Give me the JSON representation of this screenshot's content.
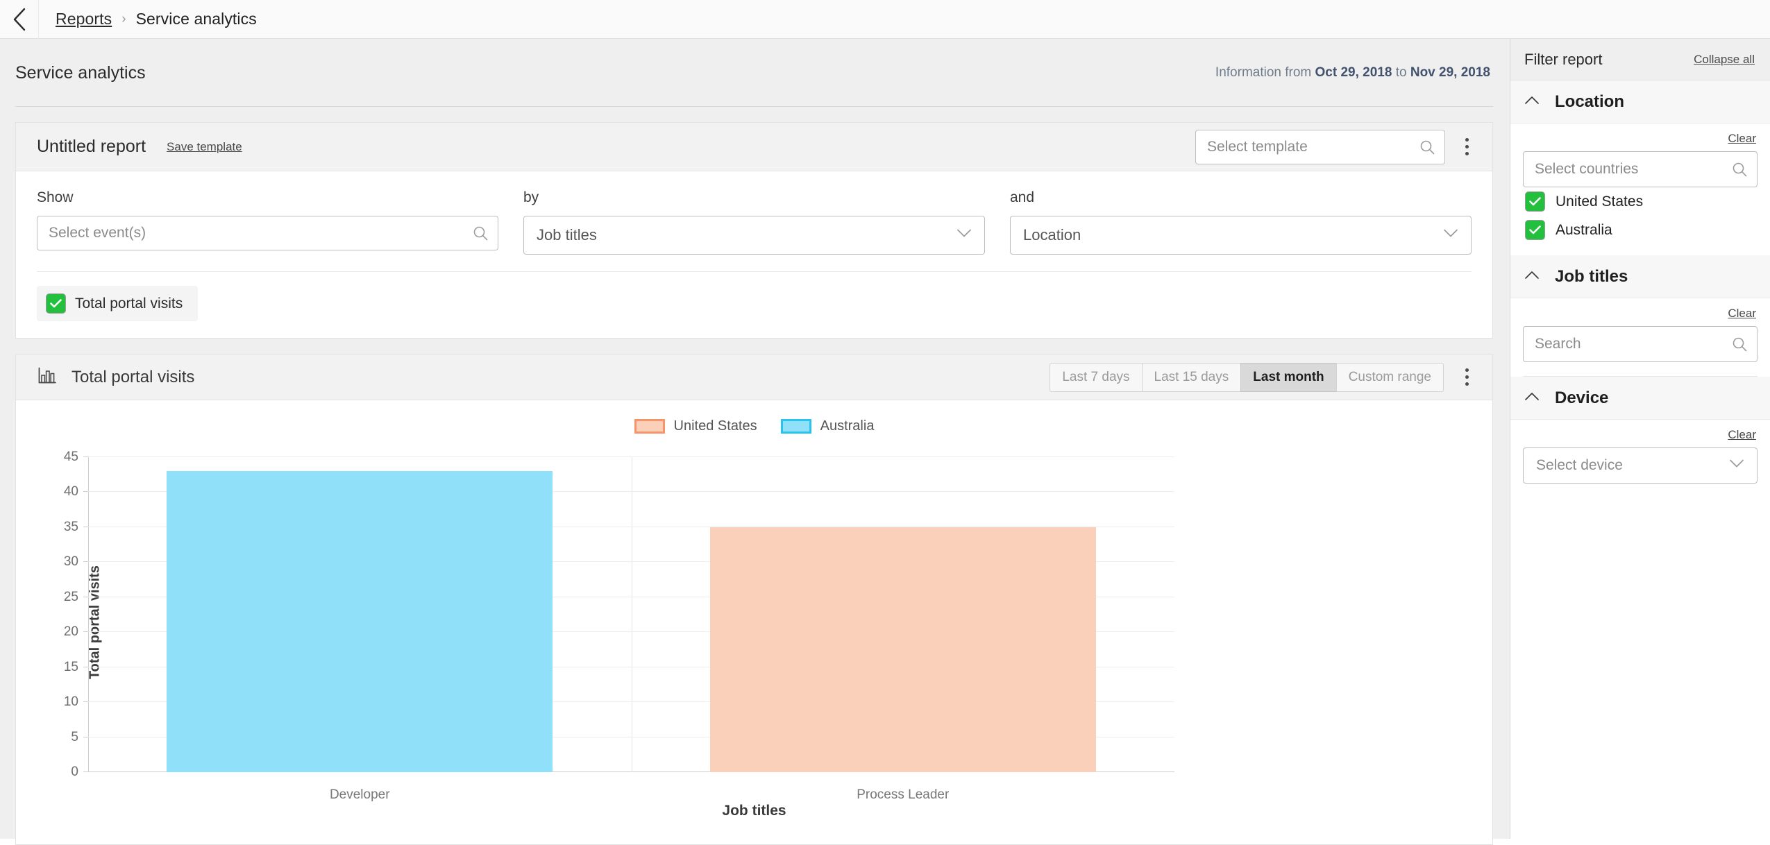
{
  "topbar": {
    "back_icon": "chevron-left-icon",
    "breadcrumb_parent": "Reports",
    "breadcrumb_separator": "›",
    "breadcrumb_current": "Service analytics"
  },
  "page": {
    "title": "Service analytics",
    "info_prefix": "Information from ",
    "info_from": "Oct 29, 2018",
    "info_mid": " to ",
    "info_to": "Nov 29, 2018"
  },
  "report_card": {
    "title": "Untitled report",
    "save_template": "Save template",
    "template_placeholder": "Select template",
    "search_icon": "search-icon",
    "menu_icon": "kebab-menu-icon",
    "fields": [
      {
        "label": "Show",
        "value": "Select event(s)",
        "kind": "search"
      },
      {
        "label": "by",
        "value": "Job titles",
        "kind": "select"
      },
      {
        "label": "and",
        "value": "Location",
        "kind": "select"
      }
    ],
    "chip": {
      "label": "Total portal visits",
      "checked": true,
      "check_icon": "checkmark-icon"
    }
  },
  "chart_card": {
    "icon": "bar-chart-icon",
    "title": "Total portal visits",
    "range_buttons": [
      {
        "label": "Last 7 days",
        "active": false
      },
      {
        "label": "Last 15 days",
        "active": false
      },
      {
        "label": "Last month",
        "active": true
      },
      {
        "label": "Custom range",
        "active": false
      }
    ],
    "menu_icon": "kebab-menu-icon"
  },
  "chart_data": {
    "type": "bar",
    "title": "Total portal visits",
    "categories": [
      "Developer",
      "Process Leader"
    ],
    "series": [
      {
        "name": "United States",
        "values": [
          0,
          35
        ],
        "color": "#FBD0BA",
        "border": "#F79569"
      },
      {
        "name": "Australia",
        "values": [
          43,
          0
        ],
        "color": "#8FE0F8",
        "border": "#29C3F0"
      }
    ],
    "xlabel": "Job titles",
    "ylabel": "Total portal visits",
    "ylim": [
      0,
      45
    ],
    "yticks": [
      0,
      5,
      10,
      15,
      20,
      25,
      30,
      35,
      40,
      45
    ],
    "grid": true,
    "legend_position": "top-center"
  },
  "filters": {
    "title": "Filter report",
    "collapse_all": "Collapse all",
    "collapse_icon": "chevron-up-icon",
    "search_icon": "search-icon",
    "caret_icon": "chevron-down-icon",
    "check_icon": "checkmark-icon",
    "sections": [
      {
        "title": "Location",
        "clear": "Clear",
        "input_placeholder": "Select countries",
        "input_kind": "search",
        "options": [
          {
            "label": "United States",
            "checked": true
          },
          {
            "label": "Australia",
            "checked": true
          }
        ]
      },
      {
        "title": "Job titles",
        "clear": "Clear",
        "input_placeholder": "Search",
        "input_kind": "search",
        "options": []
      },
      {
        "title": "Device",
        "clear": "Clear",
        "input_placeholder": "Select device",
        "input_kind": "select",
        "options": []
      }
    ]
  },
  "colors": {
    "green_check": "#22c03c",
    "us_fill": "#FBD0BA",
    "us_border": "#F79569",
    "au_fill": "#8FE0F8",
    "au_border": "#29C3F0"
  }
}
